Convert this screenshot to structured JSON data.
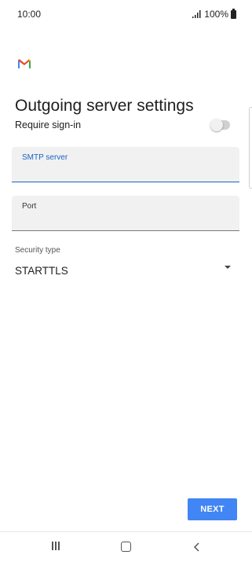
{
  "status_bar": {
    "time": "10:00",
    "battery": "100%"
  },
  "page": {
    "title": "Outgoing server settings"
  },
  "require_signin": {
    "label": "Require sign-in",
    "enabled": false
  },
  "smtp_field": {
    "label": "SMTP server",
    "value": ""
  },
  "port_field": {
    "label": "Port",
    "value": ""
  },
  "security": {
    "label": "Security type",
    "value": "STARTTLS"
  },
  "actions": {
    "next_label": "NEXT"
  },
  "colors": {
    "accent": "#1a63c7",
    "button": "#4285f4"
  },
  "icons": {
    "app": "gmail-logo",
    "signal": "signal-icon",
    "battery": "battery-icon",
    "dropdown": "dropdown-icon",
    "recents": "recents-icon",
    "home": "home-icon",
    "back": "back-icon"
  }
}
